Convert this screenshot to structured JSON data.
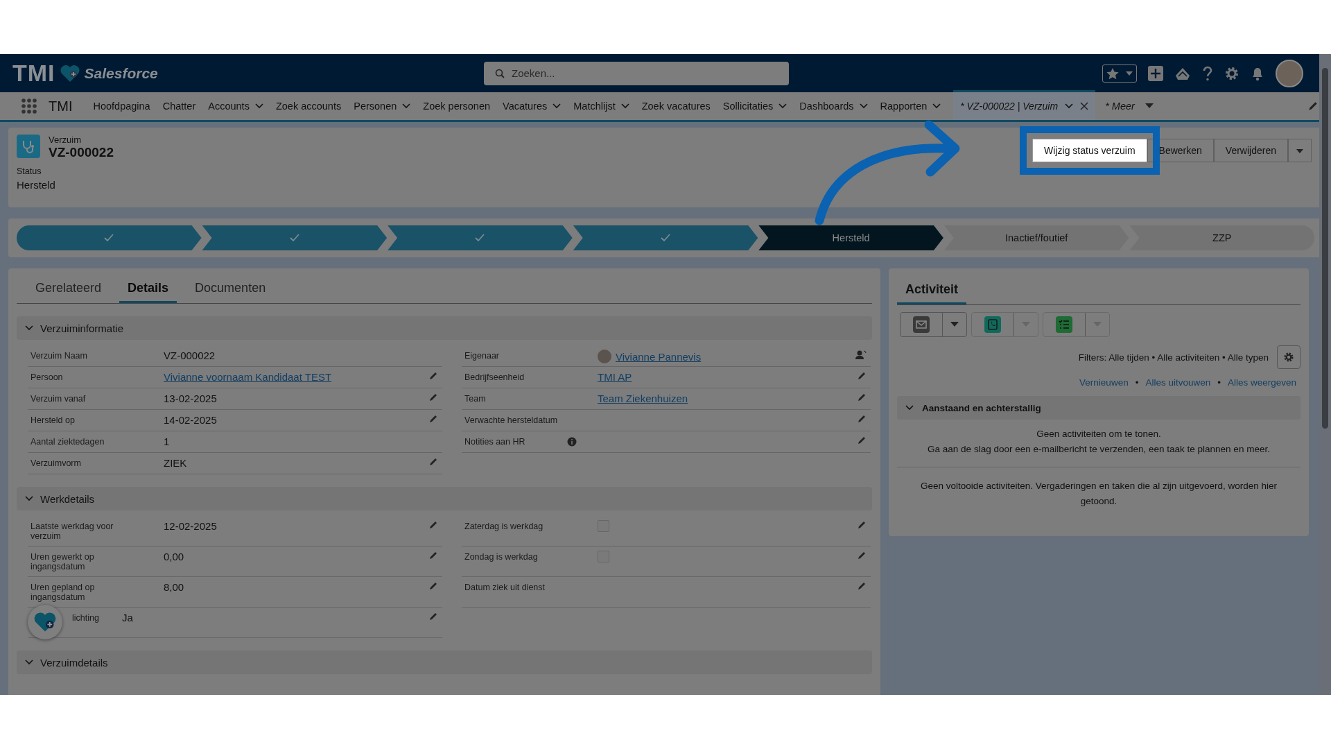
{
  "header": {
    "brand": "TMI",
    "product": "Salesforce",
    "search": {
      "placeholder": "Zoeken..."
    }
  },
  "nav": {
    "app_name": "TMI",
    "items": [
      {
        "label": "Hoofdpagina",
        "dropdown": false
      },
      {
        "label": "Chatter",
        "dropdown": false
      },
      {
        "label": "Accounts",
        "dropdown": true
      },
      {
        "label": "Zoek accounts",
        "dropdown": false
      },
      {
        "label": "Personen",
        "dropdown": true
      },
      {
        "label": "Zoek personen",
        "dropdown": false
      },
      {
        "label": "Vacatures",
        "dropdown": true
      },
      {
        "label": "Matchlijst",
        "dropdown": true
      },
      {
        "label": "Zoek vacatures",
        "dropdown": false
      },
      {
        "label": "Sollicitaties",
        "dropdown": true
      },
      {
        "label": "Dashboards",
        "dropdown": true
      },
      {
        "label": "Rapporten",
        "dropdown": true
      }
    ],
    "record_tab": {
      "label": "* VZ-000022 | Verzuim",
      "selected": true
    },
    "more": "* Meer"
  },
  "record": {
    "object_type": "Verzuim",
    "name": "VZ-000022",
    "status_label": "Status",
    "status_value": "Hersteld",
    "buttons": [
      {
        "label": "Wijzig status verzuim",
        "highlighted": true
      },
      {
        "label": "Bewerken",
        "highlighted": false
      },
      {
        "label": "Verwijderen",
        "highlighted": false
      }
    ]
  },
  "path": [
    {
      "completed": true,
      "selected": false
    },
    {
      "completed": true,
      "selected": false
    },
    {
      "completed": true,
      "selected": false
    },
    {
      "completed": true,
      "selected": false
    },
    {
      "label": "Hersteld",
      "completed": false,
      "selected": true
    },
    {
      "label": "Inactief/foutief",
      "completed": false,
      "selected": false
    },
    {
      "label": "ZZP",
      "completed": false,
      "selected": false
    }
  ],
  "tabs": [
    {
      "label": "Gerelateerd",
      "selected": false
    },
    {
      "label": "Details",
      "selected": true
    },
    {
      "label": "Documenten",
      "selected": false
    }
  ],
  "sections": [
    {
      "title": "Verzuiminformatie",
      "expanded": true,
      "left": [
        {
          "label": "Verzuim Naam",
          "kind": "text",
          "value": "VZ-000022",
          "editable": false
        },
        {
          "label": "Persoon",
          "kind": "link",
          "value": "Vivianne voornaam Kandidaat TEST",
          "editable": true
        },
        {
          "label": "Verzuim vanaf",
          "kind": "text",
          "value": "13-02-2025",
          "editable": true
        },
        {
          "label": "Hersteld op",
          "kind": "text",
          "value": "14-02-2025",
          "editable": true
        },
        {
          "label": "Aantal ziektedagen",
          "kind": "text",
          "value": "1",
          "editable": false
        },
        {
          "label": "Verzuimvorm",
          "kind": "text",
          "value": "ZIEK",
          "editable": true
        }
      ],
      "right": [
        {
          "label": "Eigenaar",
          "kind": "owner",
          "value": "Vivianne Pannevis",
          "editable": false
        },
        {
          "label": "Bedrijfseenheid",
          "kind": "link",
          "value": "TMI AP",
          "editable": true
        },
        {
          "label": "Team",
          "kind": "link",
          "value": "Team Ziekenhuizen",
          "editable": true
        },
        {
          "label": "Verwachte hersteldatum",
          "kind": "text",
          "editable": true
        },
        {
          "label": "Notities aan HR",
          "kind": "text",
          "info": true,
          "editable": true
        }
      ]
    },
    {
      "title": "Werkdetails",
      "expanded": true,
      "left": [
        {
          "label": "Laatste werkdag voor verzuim",
          "kind": "text",
          "value": "12-02-2025",
          "editable": true
        },
        {
          "label": "Uren gewerkt op ingangsdatum",
          "kind": "text",
          "value": "0,00",
          "editable": true
        },
        {
          "label": "Uren gepland op ingangsdatum",
          "kind": "text",
          "value": "8,00",
          "editable": true
        },
        {
          "label": "lichting",
          "kind": "text",
          "value": "Ja",
          "editable": true
        }
      ],
      "right": [
        {
          "label": "Zaterdag is werkdag",
          "kind": "checkbox",
          "checked": false,
          "editable": true
        },
        {
          "label": "Zondag is werkdag",
          "kind": "checkbox",
          "checked": false,
          "editable": true
        },
        {
          "label": "Datum ziek uit dienst",
          "kind": "text",
          "editable": true
        }
      ]
    },
    {
      "title": "Verzuimdetails",
      "expanded": true
    }
  ],
  "activity": {
    "title": "Activiteit",
    "actions": [
      {
        "kind": "email",
        "disabled": false
      },
      {
        "kind": "call",
        "disabled": true
      },
      {
        "kind": "task",
        "disabled": true
      }
    ],
    "filters": "Filters: Alle tijden • Alle activiteiten • Alle typen",
    "links": [
      "Vernieuwen",
      "Alles uitvouwen",
      "Alles weergeven"
    ],
    "link_separators": [
      "•",
      "•"
    ],
    "section": {
      "title": "Aanstaand en achterstallig",
      "expanded": true
    },
    "empty_lines": [
      "Geen activiteiten om te tonen.",
      "Ga aan de slag door een e-mailbericht te verzenden, een taak te plannen en meer."
    ],
    "completed_note": "Geen voltooide activiteiten. Vergaderingen en taken die al zijn uitgevoerd, worden hier getoond."
  }
}
